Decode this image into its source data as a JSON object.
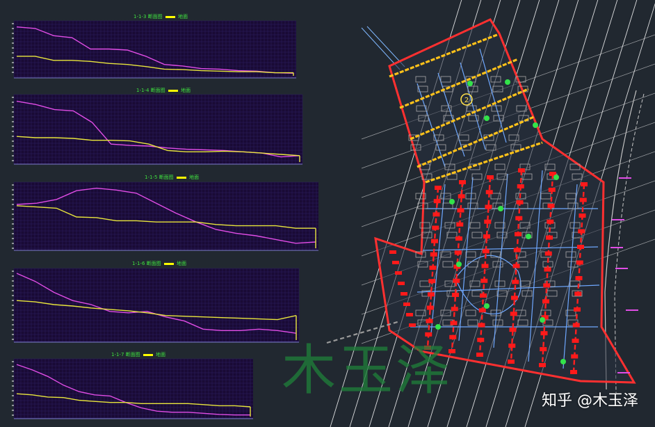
{
  "panels": [
    {
      "code": "1-1-3",
      "title_mid": "断面图",
      "legend": "地面"
    },
    {
      "code": "1-1-4",
      "title_mid": "断面图",
      "legend": "地面"
    },
    {
      "code": "1-1-5",
      "title_mid": "断面图",
      "legend": "地面"
    },
    {
      "code": "1-1-6",
      "title_mid": "断面图",
      "legend": "地面"
    },
    {
      "code": "1-1-7",
      "title_mid": "断面图",
      "legend": "地面"
    }
  ],
  "plan": {
    "section_marker": "2",
    "pink_labels": [
      "",
      "",
      "",
      "",
      "",
      ""
    ]
  },
  "watermark": {
    "big_text": "木玉泽",
    "credit": "知乎 @木玉泽"
  },
  "colors": {
    "panel_bg": "#190a35",
    "grid": "#2c1f63",
    "terrain": "#e14de6",
    "design": "#e9e63c",
    "boundary": "#ff3030",
    "road": "#ffffff",
    "section_line": "#ffc21a"
  },
  "chart_data": [
    {
      "type": "line",
      "title": "1-1-3 断面图",
      "series": [
        {
          "name": "",
          "values": [
            0.95,
            0.92,
            0.78,
            0.74,
            0.52,
            0.52,
            0.5,
            0.38,
            0.22,
            0.19,
            0.14,
            0.13,
            0.1,
            0.09,
            0.06,
            0.05
          ]
        },
        {
          "name": "地面",
          "values": [
            0.38,
            0.38,
            0.3,
            0.3,
            0.28,
            0.24,
            0.22,
            0.18,
            0.13,
            0.12,
            0.1,
            0.09,
            0.08,
            0.08,
            0.06,
            0.06
          ]
        }
      ]
    },
    {
      "type": "line",
      "title": "1-1-4 断面图",
      "series": [
        {
          "name": "",
          "values": [
            0.95,
            0.9,
            0.82,
            0.8,
            0.62,
            0.28,
            0.26,
            0.25,
            0.22,
            0.2,
            0.19,
            0.18,
            0.16,
            0.14,
            0.08,
            0.1
          ]
        },
        {
          "name": "地面",
          "values": [
            0.4,
            0.38,
            0.38,
            0.37,
            0.34,
            0.34,
            0.33,
            0.28,
            0.18,
            0.16,
            0.16,
            0.17,
            0.16,
            0.14,
            0.12,
            0.1
          ]
        }
      ]
    },
    {
      "type": "line",
      "title": "1-1-5 断面图",
      "series": [
        {
          "name": "",
          "values": [
            0.7,
            0.72,
            0.78,
            0.92,
            0.96,
            0.93,
            0.88,
            0.72,
            0.56,
            0.42,
            0.3,
            0.24,
            0.2,
            0.14,
            0.08,
            0.1
          ]
        },
        {
          "name": "地面",
          "values": [
            0.68,
            0.66,
            0.64,
            0.5,
            0.49,
            0.44,
            0.44,
            0.42,
            0.42,
            0.42,
            0.38,
            0.36,
            0.36,
            0.36,
            0.32,
            0.32
          ]
        }
      ]
    },
    {
      "type": "line",
      "title": "1-1-6 断面图",
      "series": [
        {
          "name": "",
          "values": [
            0.98,
            0.86,
            0.7,
            0.58,
            0.52,
            0.42,
            0.4,
            0.42,
            0.34,
            0.28,
            0.16,
            0.14,
            0.14,
            0.16,
            0.14,
            0.1
          ]
        },
        {
          "name": "地面",
          "values": [
            0.58,
            0.56,
            0.52,
            0.5,
            0.47,
            0.45,
            0.43,
            0.4,
            0.36,
            0.35,
            0.34,
            0.33,
            0.32,
            0.31,
            0.3,
            0.36
          ]
        }
      ]
    },
    {
      "type": "line",
      "title": "1-1-7 断面图",
      "series": [
        {
          "name": "",
          "values": [
            0.96,
            0.86,
            0.74,
            0.58,
            0.46,
            0.4,
            0.38,
            0.26,
            0.16,
            0.1,
            0.08,
            0.08,
            0.06,
            0.04,
            0.03,
            0.03
          ]
        },
        {
          "name": "地面",
          "values": [
            0.42,
            0.4,
            0.36,
            0.35,
            0.3,
            0.28,
            0.26,
            0.26,
            0.24,
            0.24,
            0.24,
            0.24,
            0.22,
            0.2,
            0.2,
            0.18
          ]
        }
      ]
    }
  ]
}
